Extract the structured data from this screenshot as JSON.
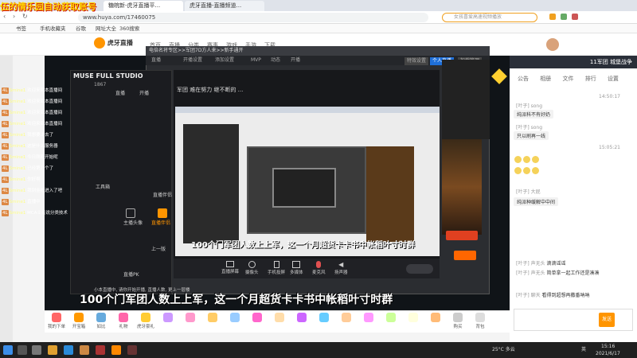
{
  "overlay_title": "伍的情乐园自动获取账号",
  "browser": {
    "tabs": [
      "糖皖新-虎牙直播平...",
      "虎牙直播-直播频道..."
    ],
    "url": "www.huya.com/17460075",
    "search_placeholder": "女孩喜爱高速视频播放",
    "bookmarks": [
      "书签",
      "手机收藏夹",
      "谷歌",
      "网址大全",
      "360搜索"
    ]
  },
  "huya": {
    "logo_text": "虎牙直播",
    "logo_sub": "huya.com",
    "nav": [
      "首页",
      "直播",
      "分类",
      "赛事",
      "游戏",
      "手游",
      "下载"
    ]
  },
  "tool": {
    "title": "电倍名将专区>>军团7D方人来>>新手通开",
    "tabs": [
      "直播",
      "开播设置",
      "添加设置",
      "MVP",
      "动态",
      "开播"
    ],
    "right_tabs": [
      "特效设置",
      "个人直播",
      "加载管理"
    ]
  },
  "app": {
    "brand": "MUSE FULL STUDIO",
    "user_count": "1867",
    "menu": [
      "直播",
      "开播",
      "工具箱",
      "直播伴侣",
      "我的",
      "上一版",
      "直播PK"
    ],
    "labels": [
      "场景",
      "画面",
      "主播头像",
      "直播伴侣",
      "上传一起玩",
      "互动PK"
    ]
  },
  "preview": {
    "title": "军团 难在努力 继不断的 ...",
    "controls": [
      "直播屏幕",
      "摄像头",
      "手机投屏",
      "多媒体",
      "麦克风",
      "扬声器"
    ],
    "status_text": "小本直播中, 请你开始开播, 直播人数, 更上一层楼"
  },
  "right_panel": {
    "header": "11军团 城堡战争",
    "tabs": [
      "公告",
      "相册",
      "文件",
      "排行",
      "设置"
    ],
    "messages": [
      {
        "name": "[叶子] song",
        "text": "纯派科不有好奶"
      },
      {
        "name": "[叶子] song",
        "text": "只以刷再一线"
      },
      {
        "name": "[叶子] 大屁",
        "text": "纯派种缓解中中间"
      },
      {
        "name": "[叶子] 声无头",
        "text": "滴滴谣谣"
      },
      {
        "name": "[叶子] 声无头",
        "text": "简单拿一起工作还是凑凑"
      },
      {
        "name": "[叶子] 聊天",
        "text": "看得到超想再撒番呐呐"
      }
    ],
    "times": [
      "14:50:17",
      "15:05:21"
    ],
    "send_label": "发送"
  },
  "left_chat": [
    {
      "lvl": "4L",
      "name": "Smine1",
      "text": "欢迎来到本直播间"
    },
    {
      "lvl": "4L",
      "name": "Smine1",
      "text": "欢迎来到本直播间"
    },
    {
      "lvl": "4L",
      "name": "Smine1",
      "text": "欢迎来到本直播间"
    },
    {
      "lvl": "4L",
      "name": "Smine1",
      "text": "欢迎来到本直播间"
    },
    {
      "lvl": "4L",
      "name": "Smine1",
      "text": "我想要上去了"
    },
    {
      "lvl": "4L",
      "name": "Smine1",
      "text": "这是什么服务器"
    },
    {
      "lvl": "4L",
      "name": "Smine1",
      "text": "今日刚刚开始呢"
    },
    {
      "lvl": "4L",
      "name": "Smine1",
      "text": "已经第几个了"
    },
    {
      "lvl": "4L",
      "name": "Smine1",
      "text": "你好啊"
    },
    {
      "lvl": "4L",
      "name": "Smine1",
      "text": "我到金线进入了吧"
    },
    {
      "lvl": "4L",
      "name": "Smine1",
      "text": "直播中"
    },
    {
      "lvl": "4L",
      "name": "Smine1",
      "text": "MCA士兵说分类技术"
    }
  ],
  "subtitle": "100个门军团人数上上军，这一个月超货卡卡书中帐稻叶寸时群",
  "gifts": [
    "我的下单",
    "开宝箱",
    "如比",
    "礼物",
    "虎牙豪礼",
    "",
    "",
    "",
    "",
    "",
    "",
    "",
    "",
    "",
    "",
    "",
    "",
    "",
    "购买",
    "背包"
  ],
  "taskbar": {
    "temperature": "25°C 多云",
    "time": "15:16",
    "date": "2021/6/17",
    "lang": "英"
  },
  "colors": {
    "huya_orange": "#ff9500",
    "dark_bg": "#1b1c20",
    "accent_red": "#e04020"
  }
}
